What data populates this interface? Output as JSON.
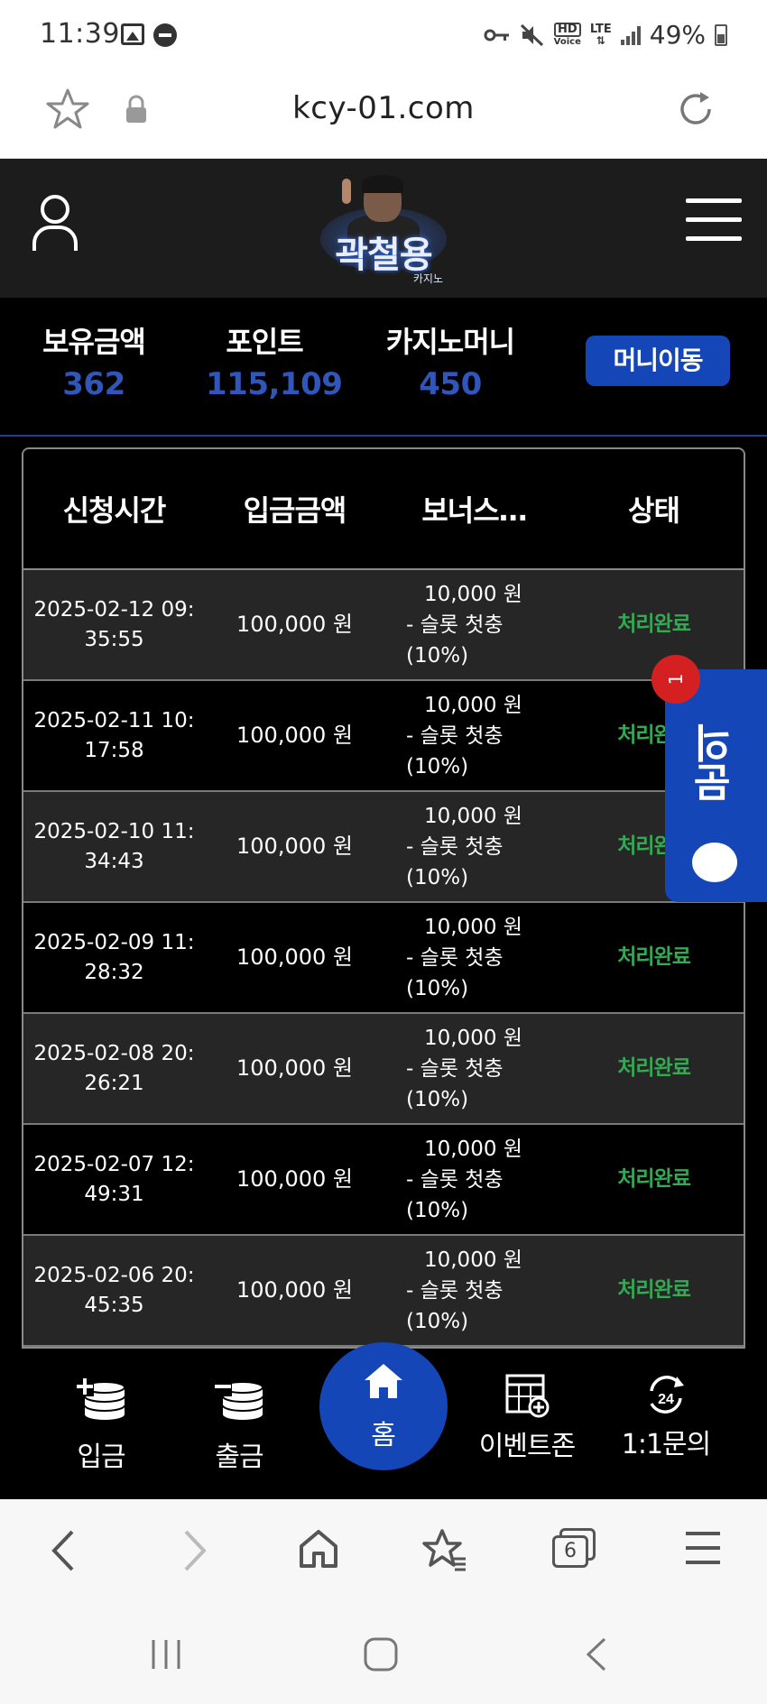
{
  "status_bar": {
    "time": "11:39",
    "battery": "49%",
    "hd_voice_top": "HD",
    "hd_voice_bottom": "Voice",
    "lte": "LTE"
  },
  "browser": {
    "url": "kcy-01.com",
    "tab_count": "6"
  },
  "site": {
    "logo_text": "곽철용",
    "logo_sub": "카지노"
  },
  "balances": {
    "holding_label": "보유금액",
    "holding_value": "362",
    "points_label": "포인트",
    "points_value": "115,109",
    "casino_label": "카지노머니",
    "casino_value": "450",
    "move_button": "머니이동"
  },
  "table": {
    "headers": {
      "time": "신청시간",
      "amount": "입금금액",
      "bonus": "보너스…",
      "status": "상태"
    },
    "rows": [
      {
        "time": "2025-02-12 09:35:55",
        "amount": "100,000 원",
        "bonus_amount": "10,000 원",
        "bonus_desc": "- 슬롯 첫충 (10%)",
        "status": "처리완료"
      },
      {
        "time": "2025-02-11 10:17:58",
        "amount": "100,000 원",
        "bonus_amount": "10,000 원",
        "bonus_desc": "- 슬롯 첫충 (10%)",
        "status": "처리완료"
      },
      {
        "time": "2025-02-10 11:34:43",
        "amount": "100,000 원",
        "bonus_amount": "10,000 원",
        "bonus_desc": "- 슬롯 첫충 (10%)",
        "status": "처리완료"
      },
      {
        "time": "2025-02-09 11:28:32",
        "amount": "100,000 원",
        "bonus_amount": "10,000 원",
        "bonus_desc": "- 슬롯 첫충 (10%)",
        "status": "처리완료"
      },
      {
        "time": "2025-02-08 20:26:21",
        "amount": "100,000 원",
        "bonus_amount": "10,000 원",
        "bonus_desc": "- 슬롯 첫충 (10%)",
        "status": "처리완료"
      },
      {
        "time": "2025-02-07 12:49:31",
        "amount": "100,000 원",
        "bonus_amount": "10,000 원",
        "bonus_desc": "- 슬롯 첫충 (10%)",
        "status": "처리완료"
      },
      {
        "time": "2025-02-06 20:45:35",
        "amount": "100,000 원",
        "bonus_amount": "10,000 원",
        "bonus_desc": "- 슬롯 첫충 (10%)",
        "status": "처리완료"
      }
    ]
  },
  "chat_tab": {
    "label": "문의",
    "badge": "1"
  },
  "bottom_nav": {
    "deposit": "입금",
    "withdraw": "출금",
    "home": "홈",
    "event_zone": "이벤트존",
    "inquiry": "1:1문의",
    "inquiry_icon_text": "24"
  },
  "colors": {
    "accent_blue": "#1446b8",
    "value_blue": "#2f56b8",
    "status_green": "#34a853",
    "badge_red": "#d42020"
  }
}
